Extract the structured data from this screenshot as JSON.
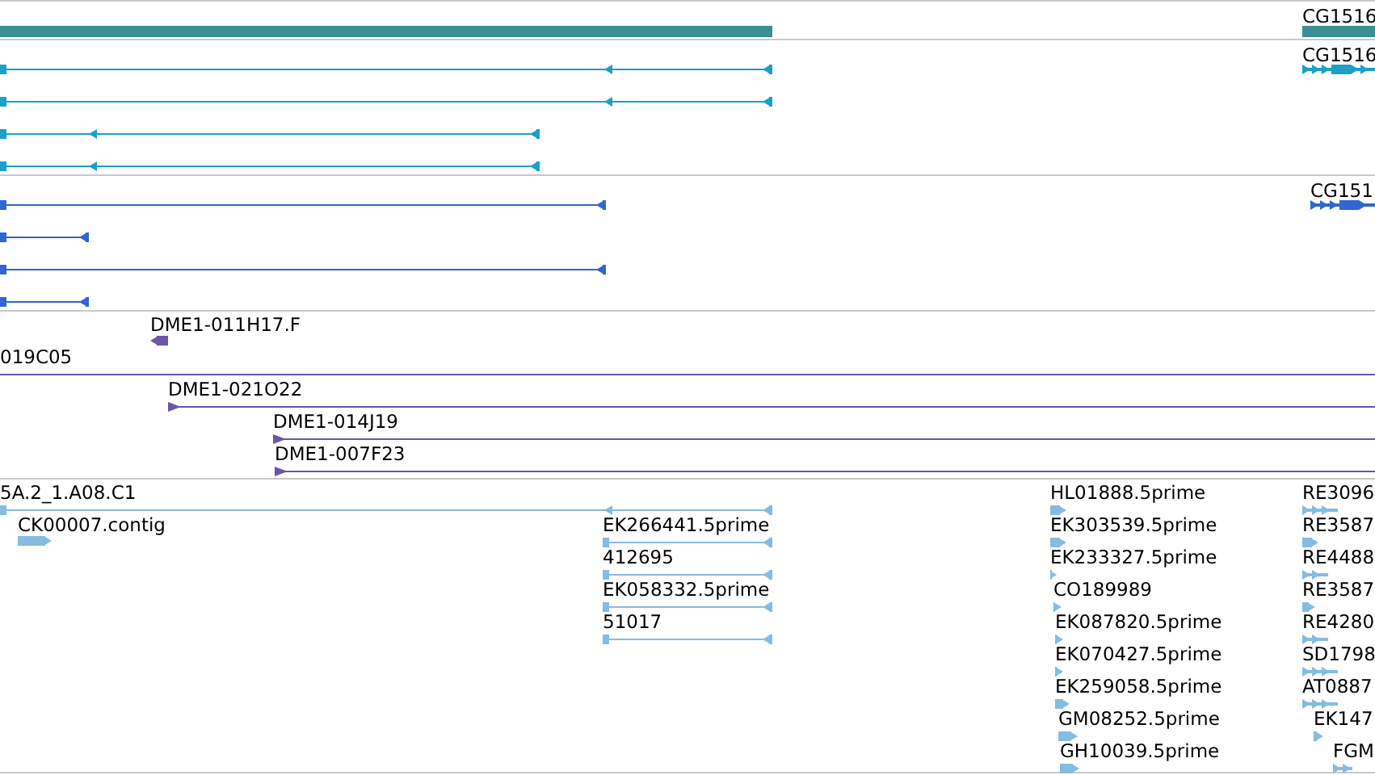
{
  "tracks": [
    {
      "color": "#3a8f94",
      "features": [
        {
          "kind": "bar"
        },
        {
          "kind": "bar",
          "label": "CG1516"
        }
      ]
    },
    {
      "color": "#1ba0c6",
      "features": [
        {
          "kind": "transcript",
          "reverse": true
        },
        {
          "kind": "transcript",
          "reverse": true
        },
        {
          "kind": "transcript",
          "reverse": true
        },
        {
          "kind": "transcript",
          "reverse": true
        },
        {
          "kind": "cluster",
          "reverse": false,
          "label": "CG1516"
        }
      ]
    },
    {
      "color": "#2f66cf",
      "features": [
        {
          "kind": "transcript",
          "reverse": true
        },
        {
          "kind": "transcript",
          "reverse": true
        },
        {
          "kind": "transcript",
          "reverse": true
        },
        {
          "kind": "transcript",
          "reverse": true
        },
        {
          "kind": "cluster",
          "reverse": false,
          "label": "CG151"
        }
      ]
    },
    {
      "color": "#6a55a8",
      "features": [
        {
          "kind": "arrow",
          "reverse": true,
          "label": "DME1-011H17.F"
        },
        {
          "kind": "line",
          "label": "019C05"
        },
        {
          "kind": "line",
          "reverse": false,
          "label": "DME1-021O22"
        },
        {
          "kind": "line",
          "reverse": false,
          "label": "DME1-014J19"
        },
        {
          "kind": "line",
          "reverse": false,
          "label": "DME1-007F23"
        }
      ]
    },
    {
      "color": "#86bce0",
      "features": [
        {
          "kind": "transcript",
          "reverse": true,
          "label": "5A.2_1.A08.C1"
        },
        {
          "kind": "arrow",
          "reverse": false,
          "label": "CK00007.contig"
        },
        {
          "kind": "transcript",
          "reverse": true,
          "label": "EK266441.5prime"
        },
        {
          "kind": "transcript",
          "reverse": true,
          "label": "412695"
        },
        {
          "kind": "transcript",
          "reverse": true,
          "label": "EK058332.5prime"
        },
        {
          "kind": "transcript",
          "reverse": true,
          "label": "51017"
        },
        {
          "kind": "arrow",
          "reverse": false,
          "label": "HL01888.5prime"
        },
        {
          "kind": "arrow",
          "reverse": false,
          "label": "EK303539.5prime"
        },
        {
          "kind": "arrow",
          "reverse": false,
          "label": "EK233327.5prime"
        },
        {
          "kind": "arrow",
          "reverse": false,
          "label": "CO189989"
        },
        {
          "kind": "arrow",
          "reverse": false,
          "label": "EK087820.5prime"
        },
        {
          "kind": "arrow",
          "reverse": false,
          "label": "EK070427.5prime"
        },
        {
          "kind": "arrow",
          "reverse": false,
          "label": "EK259058.5prime"
        },
        {
          "kind": "arrow",
          "reverse": false,
          "label": "GM08252.5prime"
        },
        {
          "kind": "arrow",
          "reverse": false,
          "label": "GH10039.5prime"
        },
        {
          "kind": "cluster",
          "reverse": false,
          "label": "RE3096"
        },
        {
          "kind": "arrow",
          "reverse": false,
          "label": "RE3587"
        },
        {
          "kind": "cluster",
          "reverse": false,
          "label": "RE4488"
        },
        {
          "kind": "arrow",
          "reverse": false,
          "label": "RE3587"
        },
        {
          "kind": "cluster",
          "reverse": false,
          "label": "RE4280"
        },
        {
          "kind": "cluster",
          "reverse": false,
          "label": "SD1798"
        },
        {
          "kind": "cluster",
          "reverse": false,
          "label": "AT0887"
        },
        {
          "kind": "arrow",
          "reverse": false,
          "label": "EK147"
        },
        {
          "kind": "cluster",
          "reverse": false,
          "label": "FGM"
        }
      ]
    }
  ]
}
